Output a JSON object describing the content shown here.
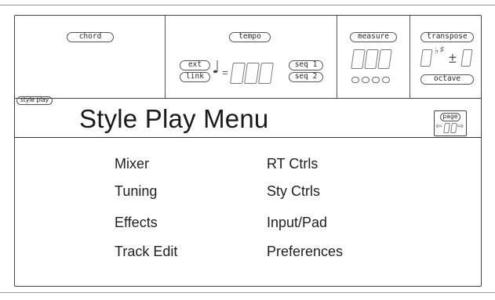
{
  "top_bar": {
    "chord_label": "chord",
    "tempo_label": "tempo",
    "ext_label": "ext",
    "link_label": "link",
    "tempo_equals": "=",
    "seq1_label": "seq 1",
    "seq2_label": "seq 2",
    "measure_label": "measure",
    "transpose_label": "transpose",
    "octave_label": "octave",
    "transpose_sign": "±"
  },
  "page": {
    "mode_tag": "style play",
    "title": "Style Play Menu",
    "page_label": "page"
  },
  "menu": {
    "left": [
      "Mixer",
      "Tuning",
      "Effects",
      "Track Edit"
    ],
    "right": [
      "RT Ctrls",
      "Sty Ctrls",
      "Input/Pad",
      "Preferences"
    ]
  },
  "icons": [
    "quarter-note-icon",
    "flat-icon",
    "sharp-icon",
    "page-left-arrow-icon",
    "page-right-arrow-icon"
  ]
}
